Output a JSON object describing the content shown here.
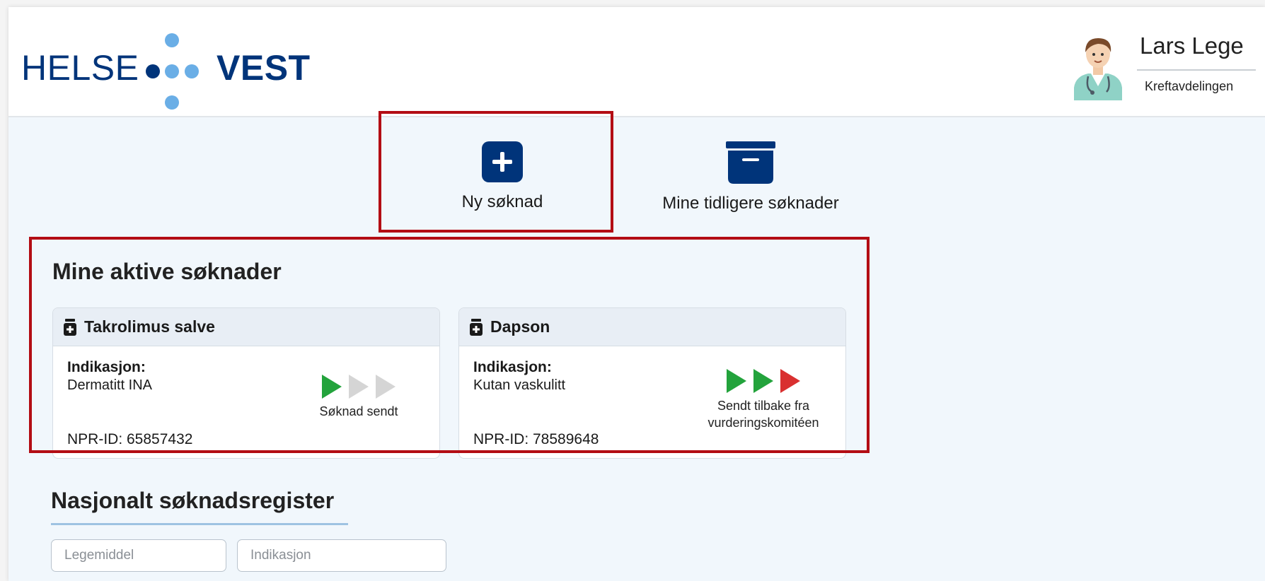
{
  "header": {
    "logo": {
      "word_left": "HELSE",
      "word_right": "VEST",
      "color": "#00347a",
      "accent": "#6aaee6"
    },
    "user": {
      "name": "Lars Lege",
      "department": "Kreftavdelingen",
      "avatar_icon": "doctor-avatar-icon"
    }
  },
  "actions": {
    "new": {
      "label": "Ny søknad",
      "icon": "plus-icon"
    },
    "archive": {
      "label": "Mine tidligere søknader",
      "icon": "archive-box-icon"
    }
  },
  "active": {
    "title": "Mine aktive søknader",
    "cards": [
      {
        "drug": "Takrolimus salve",
        "indication_label": "Indikasjon:",
        "indication": "Dermatitt INA",
        "npr": "NPR-ID: 65857432",
        "steps": [
          "done",
          "pending",
          "pending"
        ],
        "status": "Søknad sendt"
      },
      {
        "drug": "Dapson",
        "indication_label": "Indikasjon:",
        "indication": "Kutan vaskulitt",
        "npr": "NPR-ID: 78589648",
        "steps": [
          "done",
          "done",
          "returned"
        ],
        "status_line1": "Sendt tilbake fra",
        "status_line2": "vurderingskomitéen"
      }
    ]
  },
  "register": {
    "title": "Nasjonalt søknadsregister",
    "drug_placeholder": "Legemiddel",
    "indication_placeholder": "Indikasjon"
  },
  "colors": {
    "brand": "#00347a",
    "highlight": "#b30d14",
    "step_done": "#23a33c",
    "step_pending": "#d5d5d5",
    "step_returned": "#d93030"
  }
}
